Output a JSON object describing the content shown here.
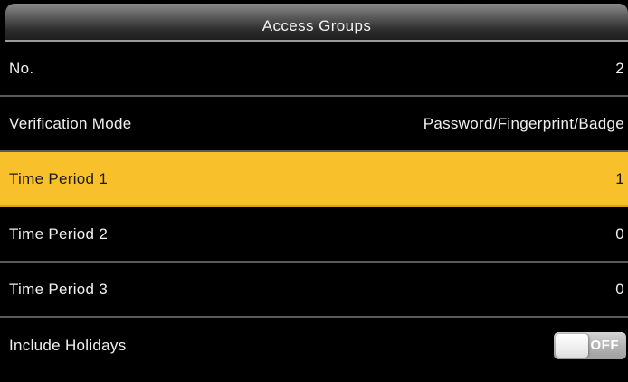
{
  "title": "Access Groups",
  "rows": [
    {
      "label": "No.",
      "value": "2"
    },
    {
      "label": "Verification Mode",
      "value": "Password/Fingerprint/Badge"
    },
    {
      "label": "Time Period 1",
      "value": "1",
      "selected": true
    },
    {
      "label": "Time Period 2",
      "value": "0"
    },
    {
      "label": "Time Period 3",
      "value": "0"
    },
    {
      "label": "Include Holidays",
      "toggle": "OFF"
    }
  ],
  "colors": {
    "selected_row": "#f8c12b",
    "background": "#000000",
    "text": "#f0f0f0"
  }
}
